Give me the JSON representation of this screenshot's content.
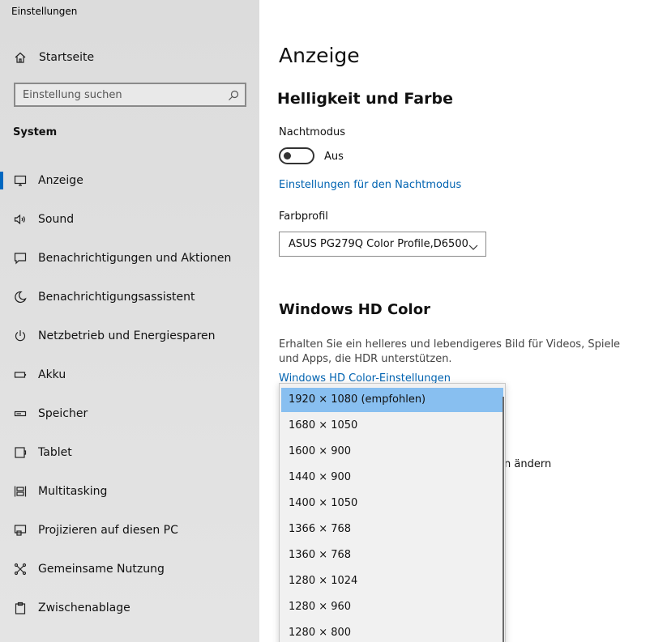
{
  "window": {
    "title": "Einstellungen"
  },
  "sidebar": {
    "home_label": "Startseite",
    "search_placeholder": "Einstellung suchen",
    "section": "System",
    "items": [
      {
        "label": "Anzeige",
        "icon": "monitor-icon",
        "active": true
      },
      {
        "label": "Sound",
        "icon": "speaker-icon"
      },
      {
        "label": "Benachrichtigungen und Aktionen",
        "icon": "message-icon"
      },
      {
        "label": "Benachrichtigungsassistent",
        "icon": "moon-icon"
      },
      {
        "label": "Netzbetrieb und Energiesparen",
        "icon": "power-icon"
      },
      {
        "label": "Akku",
        "icon": "battery-icon"
      },
      {
        "label": "Speicher",
        "icon": "storage-icon"
      },
      {
        "label": "Tablet",
        "icon": "tablet-icon"
      },
      {
        "label": "Multitasking",
        "icon": "multitasking-icon"
      },
      {
        "label": "Projizieren auf diesen PC",
        "icon": "project-icon"
      },
      {
        "label": "Gemeinsame Nutzung",
        "icon": "share-icon"
      },
      {
        "label": "Zwischenablage",
        "icon": "clipboard-icon"
      }
    ]
  },
  "main": {
    "title": "Anzeige",
    "section_brightness": "Helligkeit und Farbe",
    "night_mode_label": "Nachtmodus",
    "night_mode_state": "Aus",
    "night_mode_link": "Einstellungen für den Nachtmodus",
    "color_profile_label": "Farbprofil",
    "color_profile_value": "ASUS PG279Q Color Profile,D6500",
    "section_hdr": "Windows HD Color",
    "hdr_desc": "Erhalten Sie ein helleres und lebendigeres Bild für Videos, Spiele und Apps, die HDR unterstützen.",
    "hdr_link": "Windows HD Color-Einstellungen",
    "hidden_text_fragment": "n ändern"
  },
  "resolution_dropdown": {
    "options": [
      "1920 × 1080 (empfohlen)",
      "1680 × 1050",
      "1600 × 900",
      "1440 × 900",
      "1400 × 1050",
      "1366 × 768",
      "1360 × 768",
      "1280 × 1024",
      "1280 × 960",
      "1280 × 800"
    ],
    "selected_index": 0
  },
  "colors": {
    "accent": "#0067c0",
    "link": "#0063b1",
    "selection": "#88bff0",
    "sidebar_bg": "#e0e0e0"
  }
}
